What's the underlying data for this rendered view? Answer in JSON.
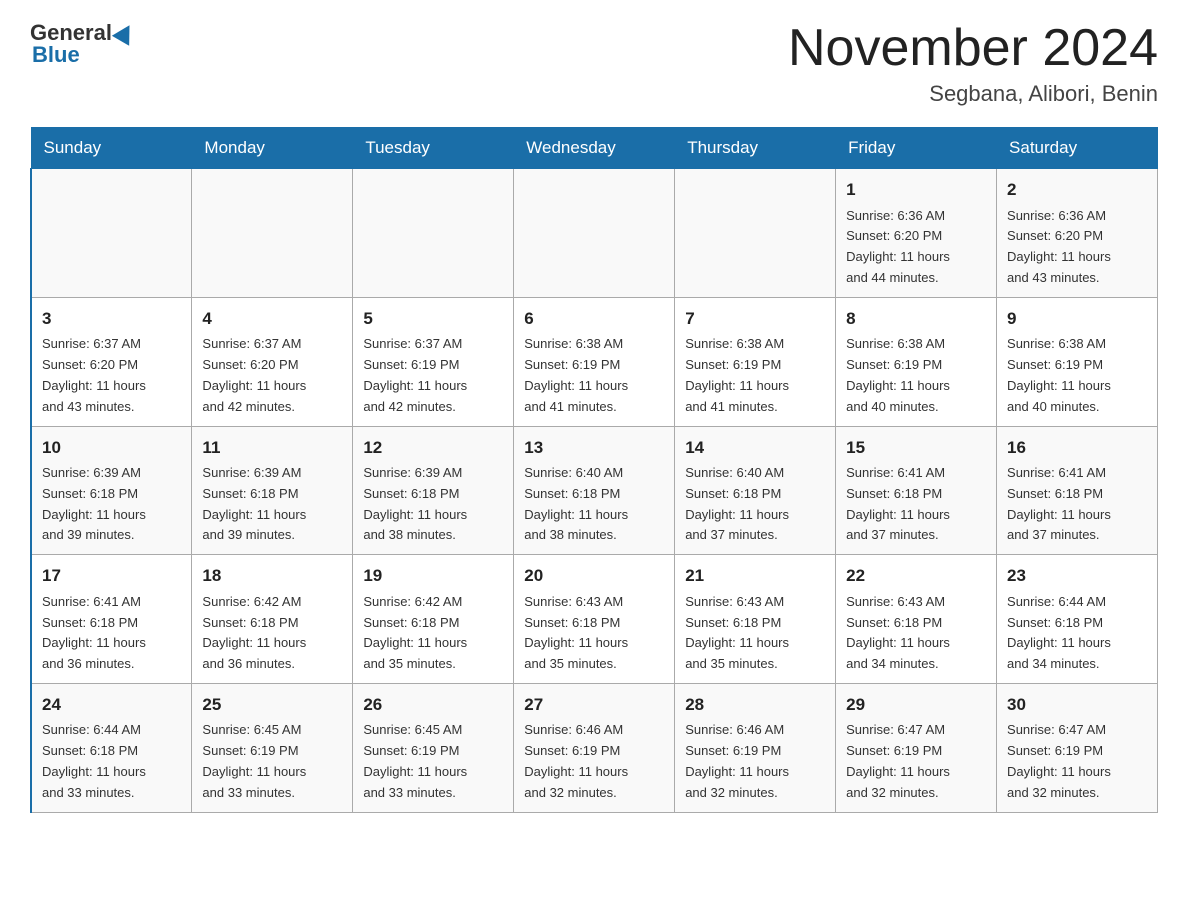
{
  "header": {
    "logo_general": "General",
    "logo_blue": "Blue",
    "month_title": "November 2024",
    "location": "Segbana, Alibori, Benin"
  },
  "weekdays": [
    "Sunday",
    "Monday",
    "Tuesday",
    "Wednesday",
    "Thursday",
    "Friday",
    "Saturday"
  ],
  "weeks": [
    {
      "days": [
        {
          "number": "",
          "info": ""
        },
        {
          "number": "",
          "info": ""
        },
        {
          "number": "",
          "info": ""
        },
        {
          "number": "",
          "info": ""
        },
        {
          "number": "",
          "info": ""
        },
        {
          "number": "1",
          "info": "Sunrise: 6:36 AM\nSunset: 6:20 PM\nDaylight: 11 hours\nand 44 minutes."
        },
        {
          "number": "2",
          "info": "Sunrise: 6:36 AM\nSunset: 6:20 PM\nDaylight: 11 hours\nand 43 minutes."
        }
      ]
    },
    {
      "days": [
        {
          "number": "3",
          "info": "Sunrise: 6:37 AM\nSunset: 6:20 PM\nDaylight: 11 hours\nand 43 minutes."
        },
        {
          "number": "4",
          "info": "Sunrise: 6:37 AM\nSunset: 6:20 PM\nDaylight: 11 hours\nand 42 minutes."
        },
        {
          "number": "5",
          "info": "Sunrise: 6:37 AM\nSunset: 6:19 PM\nDaylight: 11 hours\nand 42 minutes."
        },
        {
          "number": "6",
          "info": "Sunrise: 6:38 AM\nSunset: 6:19 PM\nDaylight: 11 hours\nand 41 minutes."
        },
        {
          "number": "7",
          "info": "Sunrise: 6:38 AM\nSunset: 6:19 PM\nDaylight: 11 hours\nand 41 minutes."
        },
        {
          "number": "8",
          "info": "Sunrise: 6:38 AM\nSunset: 6:19 PM\nDaylight: 11 hours\nand 40 minutes."
        },
        {
          "number": "9",
          "info": "Sunrise: 6:38 AM\nSunset: 6:19 PM\nDaylight: 11 hours\nand 40 minutes."
        }
      ]
    },
    {
      "days": [
        {
          "number": "10",
          "info": "Sunrise: 6:39 AM\nSunset: 6:18 PM\nDaylight: 11 hours\nand 39 minutes."
        },
        {
          "number": "11",
          "info": "Sunrise: 6:39 AM\nSunset: 6:18 PM\nDaylight: 11 hours\nand 39 minutes."
        },
        {
          "number": "12",
          "info": "Sunrise: 6:39 AM\nSunset: 6:18 PM\nDaylight: 11 hours\nand 38 minutes."
        },
        {
          "number": "13",
          "info": "Sunrise: 6:40 AM\nSunset: 6:18 PM\nDaylight: 11 hours\nand 38 minutes."
        },
        {
          "number": "14",
          "info": "Sunrise: 6:40 AM\nSunset: 6:18 PM\nDaylight: 11 hours\nand 37 minutes."
        },
        {
          "number": "15",
          "info": "Sunrise: 6:41 AM\nSunset: 6:18 PM\nDaylight: 11 hours\nand 37 minutes."
        },
        {
          "number": "16",
          "info": "Sunrise: 6:41 AM\nSunset: 6:18 PM\nDaylight: 11 hours\nand 37 minutes."
        }
      ]
    },
    {
      "days": [
        {
          "number": "17",
          "info": "Sunrise: 6:41 AM\nSunset: 6:18 PM\nDaylight: 11 hours\nand 36 minutes."
        },
        {
          "number": "18",
          "info": "Sunrise: 6:42 AM\nSunset: 6:18 PM\nDaylight: 11 hours\nand 36 minutes."
        },
        {
          "number": "19",
          "info": "Sunrise: 6:42 AM\nSunset: 6:18 PM\nDaylight: 11 hours\nand 35 minutes."
        },
        {
          "number": "20",
          "info": "Sunrise: 6:43 AM\nSunset: 6:18 PM\nDaylight: 11 hours\nand 35 minutes."
        },
        {
          "number": "21",
          "info": "Sunrise: 6:43 AM\nSunset: 6:18 PM\nDaylight: 11 hours\nand 35 minutes."
        },
        {
          "number": "22",
          "info": "Sunrise: 6:43 AM\nSunset: 6:18 PM\nDaylight: 11 hours\nand 34 minutes."
        },
        {
          "number": "23",
          "info": "Sunrise: 6:44 AM\nSunset: 6:18 PM\nDaylight: 11 hours\nand 34 minutes."
        }
      ]
    },
    {
      "days": [
        {
          "number": "24",
          "info": "Sunrise: 6:44 AM\nSunset: 6:18 PM\nDaylight: 11 hours\nand 33 minutes."
        },
        {
          "number": "25",
          "info": "Sunrise: 6:45 AM\nSunset: 6:19 PM\nDaylight: 11 hours\nand 33 minutes."
        },
        {
          "number": "26",
          "info": "Sunrise: 6:45 AM\nSunset: 6:19 PM\nDaylight: 11 hours\nand 33 minutes."
        },
        {
          "number": "27",
          "info": "Sunrise: 6:46 AM\nSunset: 6:19 PM\nDaylight: 11 hours\nand 32 minutes."
        },
        {
          "number": "28",
          "info": "Sunrise: 6:46 AM\nSunset: 6:19 PM\nDaylight: 11 hours\nand 32 minutes."
        },
        {
          "number": "29",
          "info": "Sunrise: 6:47 AM\nSunset: 6:19 PM\nDaylight: 11 hours\nand 32 minutes."
        },
        {
          "number": "30",
          "info": "Sunrise: 6:47 AM\nSunset: 6:19 PM\nDaylight: 11 hours\nand 32 minutes."
        }
      ]
    }
  ]
}
